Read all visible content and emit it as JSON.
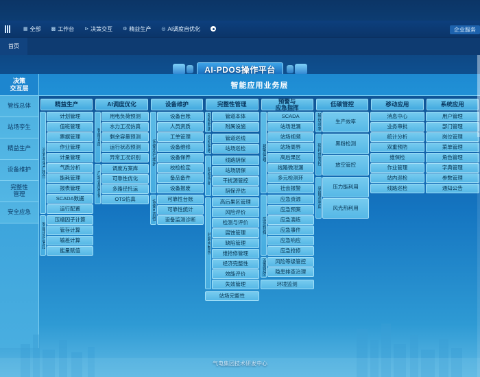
{
  "topnav": {
    "menu_icon": "hamburger-icon",
    "items": [
      {
        "label": "全部",
        "icon": "grid-icon"
      },
      {
        "label": "工作台",
        "icon": "workbench-icon"
      },
      {
        "label": "决策交互",
        "icon": "flow-icon"
      },
      {
        "label": "精益生产",
        "icon": "factory-icon"
      },
      {
        "label": "AI调度自优化",
        "icon": "target-icon"
      }
    ],
    "add_icon": "add-circle-icon",
    "right_button": "企业服务"
  },
  "tabs": [
    {
      "label": "首页",
      "active": true
    }
  ],
  "banner": {
    "title": "AI-PDOS操作平台"
  },
  "sidebar": {
    "head": "决策\n交互层",
    "items": [
      {
        "label": "管线总体"
      },
      {
        "label": "站场孪生"
      },
      {
        "label": "精益生产"
      },
      {
        "label": "设备维护"
      },
      {
        "label": "完整性\n管理"
      },
      {
        "label": "安全应急"
      }
    ]
  },
  "main": {
    "title": "智能应用业务层",
    "columns": [
      {
        "header": "精益生产",
        "groups": [
          {
            "label": "计划与生产操作",
            "items": [
              "计划管理",
              "值班管理",
              "票据管理",
              "作业管理",
              "计量管理",
              "气质分析",
              "能耗管理",
              "报表管理",
              "SCADA数据",
              "运行配置"
            ]
          },
          {
            "label": "智能运行管控",
            "items": [
              "压缩因子计算",
              "管存计算",
              "输差计算",
              "能量赋值"
            ]
          }
        ]
      },
      {
        "header": "AI调度优化",
        "groups": [
          {
            "label": "智能调度",
            "items": [
              "用电负荷预测",
              "水力工况仿真",
              "剩余容量预测",
              "运行状态预测",
              "异常工况识别"
            ]
          },
          {
            "label": "广域调度优化",
            "items": [
              "调度方案库",
              "可靠性优化",
              "多路径托运",
              "OTS仿真"
            ]
          }
        ]
      },
      {
        "header": "设备维护",
        "groups": [
          {
            "label": "设备运行维护",
            "items": [
              "设备台账",
              "人员资质",
              "工单管理",
              "设备维修",
              "设备保养",
              "校检检定",
              "备品备件",
              "设备报废"
            ]
          },
          {
            "label": "设备可靠性",
            "items": [
              "可靠性台账",
              "可靠性统计",
              "设备监测诊断"
            ]
          }
        ]
      },
      {
        "header": "完整性管理",
        "groups": [
          {
            "label": "基础数据",
            "items": [
              "管道本体",
              "附属设施"
            ]
          },
          {
            "label": "巡检管理",
            "items": [
              "管道巡线",
              "站场巡检"
            ]
          },
          {
            "label": "阴极保护",
            "items": [
              "线路阴保",
              "站场阴保",
              "干扰源管控",
              "阴保评估"
            ]
          },
          {
            "label": "线路完整性",
            "items": [
              "高后果区管理",
              "风险评价",
              "检测与评价",
              "腐蚀管理",
              "缺陷管理",
              "维抢修管理",
              "经济完整性",
              "效能评价",
              "失效管理"
            ]
          }
        ],
        "footer_item": "站场完整性"
      },
      {
        "header": "预警与\n应急指挥",
        "groups": [
          {
            "label": "报警管理",
            "items": [
              "SCADA",
              "站场泄漏",
              "站场视频",
              "站场周界",
              "高后果区",
              "线路微泄漏",
              "多元检测环",
              "社会报警"
            ]
          },
          {
            "label": "应急指挥",
            "items": [
              "应急资源",
              "应急预案",
              "应急演练",
              "应急事件",
              "应急响应",
              "应急抢修"
            ]
          },
          {
            "label": "双重预防",
            "items": [
              "风险等级管控",
              "隐患排查治理"
            ]
          }
        ],
        "footer_item": "环境监测"
      },
      {
        "header": "低碳管控",
        "groups": [
          {
            "label": "输送效率",
            "items": [
              "生产效率"
            ]
          },
          {
            "label": "碳排放管控",
            "items": [
              "黑粉检测",
              "放空管控"
            ]
          },
          {
            "label": "新能源利用",
            "items": [
              "压力能利用",
              "风光热利用"
            ]
          }
        ]
      },
      {
        "header": "移动应用",
        "groups": [
          {
            "label": "",
            "items": [
              "消息中心",
              "业务审批",
              "统计分析",
              "双重预防",
              "维保检",
              "作业管理",
              "站内巡检",
              "线路巡检"
            ]
          }
        ]
      },
      {
        "header": "系统应用",
        "groups": [
          {
            "label": "",
            "items": [
              "用户管理",
              "部门管理",
              "岗位管理",
              "菜单管理",
              "角色管理",
              "字典管理",
              "参数管理",
              "通知公告"
            ]
          }
        ]
      }
    ]
  },
  "footer": {
    "text": "气电集团技术研发中心"
  },
  "colors": {
    "accent": "#2f9ad8",
    "deep_blue": "#0d3f7d",
    "cell": "#66c3ec",
    "title_text": "#ffffff"
  }
}
